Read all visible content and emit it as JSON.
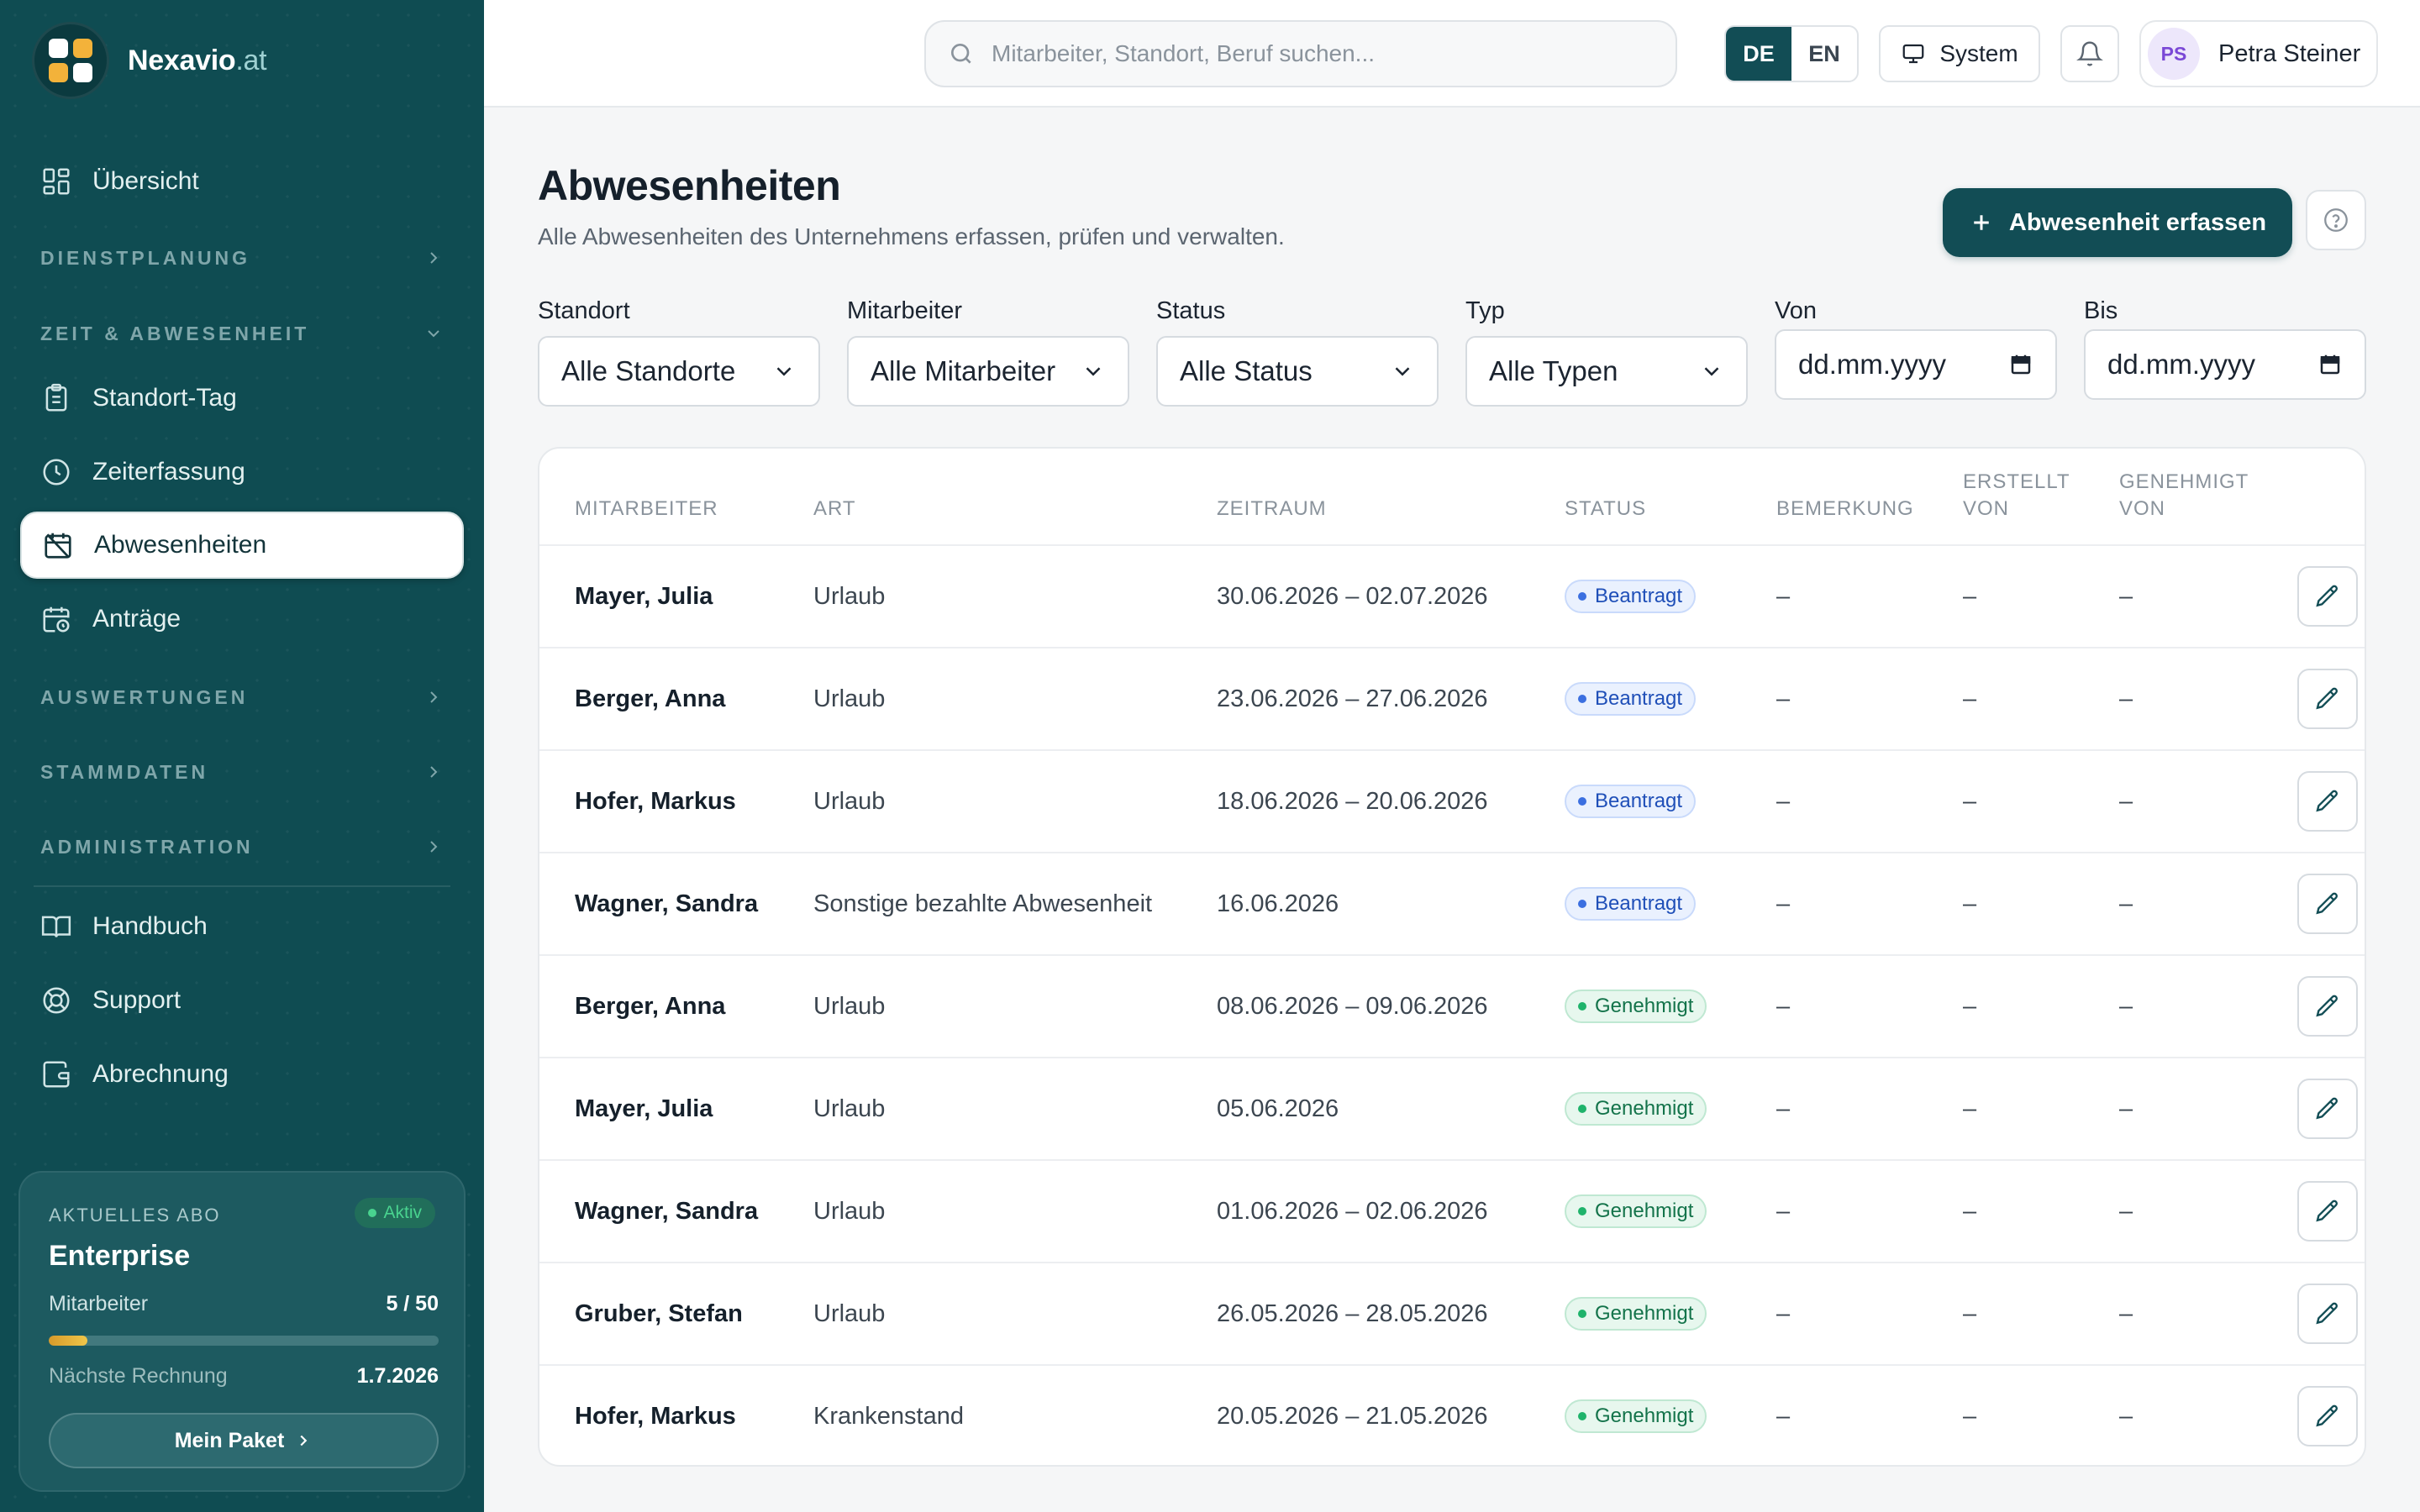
{
  "app": {
    "brand_name": "Nexavio",
    "brand_tld": ".at"
  },
  "sidebar": {
    "top_item": {
      "label": "Übersicht",
      "icon": "grid-icon"
    },
    "groups": {
      "dienstplanung": "DIENSTPLANUNG",
      "zeit": "ZEIT & ABWESENHEIT",
      "auswertungen": "AUSWERTUNGEN",
      "stammdaten": "STAMMDATEN",
      "administration": "ADMINISTRATION"
    },
    "items": [
      {
        "label": "Standort-Tag",
        "icon": "clipboard-icon"
      },
      {
        "label": "Zeiterfassung",
        "icon": "clock-icon"
      },
      {
        "label": "Abwesenheiten",
        "icon": "calendar-off-icon",
        "active": true
      },
      {
        "label": "Anträge",
        "icon": "calendar-clock-icon"
      }
    ],
    "bottom_items": [
      {
        "label": "Handbuch",
        "icon": "book-icon"
      },
      {
        "label": "Support",
        "icon": "lifebuoy-icon"
      },
      {
        "label": "Abrechnung",
        "icon": "wallet-icon"
      }
    ],
    "plan": {
      "label": "AKTUELLES ABO",
      "badge": "Aktiv",
      "name": "Enterprise",
      "employees_label": "Mitarbeiter",
      "employees_value": "5 / 50",
      "employees_fraction": 0.1,
      "next_invoice_label": "Nächste Rechnung",
      "next_invoice_value": "1.7.2026",
      "button": "Mein Paket"
    }
  },
  "topbar": {
    "search_placeholder": "Mitarbeiter, Standort, Beruf suchen...",
    "lang_de": "DE",
    "lang_en": "EN",
    "system_label": "System",
    "user_initials": "PS",
    "user_name": "Petra Steiner"
  },
  "page": {
    "title": "Abwesenheiten",
    "subtitle": "Alle Abwesenheiten des Unternehmens erfassen, prüfen und verwalten.",
    "primary_button": "Abwesenheit erfassen"
  },
  "filters": {
    "standort": {
      "label": "Standort",
      "value": "Alle Standorte"
    },
    "mitarbeiter": {
      "label": "Mitarbeiter",
      "value": "Alle Mitarbeiter"
    },
    "status": {
      "label": "Status",
      "value": "Alle Status"
    },
    "typ": {
      "label": "Typ",
      "value": "Alle Typen"
    },
    "von": {
      "label": "Von",
      "value": "dd.mm.yyyy"
    },
    "bis": {
      "label": "Bis",
      "value": "dd.mm.yyyy"
    }
  },
  "table": {
    "headers": {
      "mitarbeiter": "MITARBEITER",
      "art": "ART",
      "zeitraum": "ZEITRAUM",
      "status": "STATUS",
      "bemerkung": "BEMERKUNG",
      "erstellt_1": "ERSTELLT",
      "erstellt_2": "VON",
      "genehmigt_1": "GENEHMIGT",
      "genehmigt_2": "VON"
    },
    "rows": [
      {
        "name": "Mayer, Julia",
        "art": "Urlaub",
        "zeitraum": "30.06.2026 – 02.07.2026",
        "status": "Beantragt",
        "status_kind": "pending",
        "bemerkung": "–",
        "erstellt": "–",
        "genehmigt": "–"
      },
      {
        "name": "Berger, Anna",
        "art": "Urlaub",
        "zeitraum": "23.06.2026 – 27.06.2026",
        "status": "Beantragt",
        "status_kind": "pending",
        "bemerkung": "–",
        "erstellt": "–",
        "genehmigt": "–"
      },
      {
        "name": "Hofer, Markus",
        "art": "Urlaub",
        "zeitraum": "18.06.2026 – 20.06.2026",
        "status": "Beantragt",
        "status_kind": "pending",
        "bemerkung": "–",
        "erstellt": "–",
        "genehmigt": "–"
      },
      {
        "name": "Wagner, Sandra",
        "art": "Sonstige bezahlte Abwesenheit",
        "zeitraum": "16.06.2026",
        "status": "Beantragt",
        "status_kind": "pending",
        "bemerkung": "–",
        "erstellt": "–",
        "genehmigt": "–"
      },
      {
        "name": "Berger, Anna",
        "art": "Urlaub",
        "zeitraum": "08.06.2026 – 09.06.2026",
        "status": "Genehmigt",
        "status_kind": "approved",
        "bemerkung": "–",
        "erstellt": "–",
        "genehmigt": "–"
      },
      {
        "name": "Mayer, Julia",
        "art": "Urlaub",
        "zeitraum": "05.06.2026",
        "status": "Genehmigt",
        "status_kind": "approved",
        "bemerkung": "–",
        "erstellt": "–",
        "genehmigt": "–"
      },
      {
        "name": "Wagner, Sandra",
        "art": "Urlaub",
        "zeitraum": "01.06.2026 – 02.06.2026",
        "status": "Genehmigt",
        "status_kind": "approved",
        "bemerkung": "–",
        "erstellt": "–",
        "genehmigt": "–"
      },
      {
        "name": "Gruber, Stefan",
        "art": "Urlaub",
        "zeitraum": "26.05.2026 – 28.05.2026",
        "status": "Genehmigt",
        "status_kind": "approved",
        "bemerkung": "–",
        "erstellt": "–",
        "genehmigt": "–"
      },
      {
        "name": "Hofer, Markus",
        "art": "Krankenstand",
        "zeitraum": "20.05.2026 – 21.05.2026",
        "status": "Genehmigt",
        "status_kind": "approved",
        "bemerkung": "–",
        "erstellt": "–",
        "genehmigt": "–"
      }
    ]
  },
  "colors": {
    "sidebar": "#0f4c52",
    "accent": "#124d55",
    "pending": "#3b6fe0",
    "approved": "#1fb36b",
    "active_badge": "#49d38f"
  }
}
